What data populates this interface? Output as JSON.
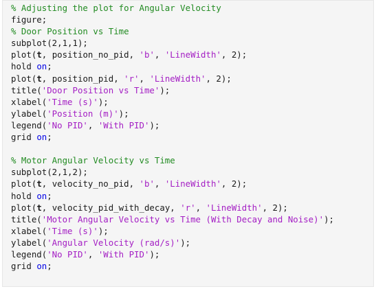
{
  "colors": {
    "background": "#f5f5f5",
    "text": "#1a1a1a",
    "comment": "#228b22",
    "string": "#a41ec4",
    "keyword": "#0000e6"
  },
  "code": {
    "lines": [
      [
        {
          "t": "% Adjusting the plot for Angular Velocity",
          "c": "comment"
        }
      ],
      [
        {
          "t": "figure;",
          "c": "plain"
        }
      ],
      [
        {
          "t": "% Door Position vs Time",
          "c": "comment"
        }
      ],
      [
        {
          "t": "subplot(2,1,1);",
          "c": "plain"
        }
      ],
      [
        {
          "t": "plot(",
          "c": "plain"
        },
        {
          "t": "t",
          "c": "bold"
        },
        {
          "t": ", position_no_pid, ",
          "c": "plain"
        },
        {
          "t": "'b'",
          "c": "string"
        },
        {
          "t": ", ",
          "c": "plain"
        },
        {
          "t": "'LineWidth'",
          "c": "string"
        },
        {
          "t": ", 2);",
          "c": "plain"
        }
      ],
      [
        {
          "t": "hold ",
          "c": "plain"
        },
        {
          "t": "on",
          "c": "keyword"
        },
        {
          "t": ";",
          "c": "plain"
        }
      ],
      [
        {
          "t": "plot(",
          "c": "plain"
        },
        {
          "t": "t",
          "c": "bold"
        },
        {
          "t": ", position_pid, ",
          "c": "plain"
        },
        {
          "t": "'r'",
          "c": "string"
        },
        {
          "t": ", ",
          "c": "plain"
        },
        {
          "t": "'LineWidth'",
          "c": "string"
        },
        {
          "t": ", 2);",
          "c": "plain"
        }
      ],
      [
        {
          "t": "title(",
          "c": "plain"
        },
        {
          "t": "'Door Position vs Time'",
          "c": "string"
        },
        {
          "t": ");",
          "c": "plain"
        }
      ],
      [
        {
          "t": "xlabel(",
          "c": "plain"
        },
        {
          "t": "'Time (s)'",
          "c": "string"
        },
        {
          "t": ");",
          "c": "plain"
        }
      ],
      [
        {
          "t": "ylabel(",
          "c": "plain"
        },
        {
          "t": "'Position (m)'",
          "c": "string"
        },
        {
          "t": ");",
          "c": "plain"
        }
      ],
      [
        {
          "t": "legend(",
          "c": "plain"
        },
        {
          "t": "'No PID'",
          "c": "string"
        },
        {
          "t": ", ",
          "c": "plain"
        },
        {
          "t": "'With PID'",
          "c": "string"
        },
        {
          "t": ");",
          "c": "plain"
        }
      ],
      [
        {
          "t": "grid ",
          "c": "plain"
        },
        {
          "t": "on",
          "c": "keyword"
        },
        {
          "t": ";",
          "c": "plain"
        }
      ],
      [],
      [
        {
          "t": "% Motor Angular Velocity vs Time",
          "c": "comment"
        }
      ],
      [
        {
          "t": "subplot(2,1,2);",
          "c": "plain"
        }
      ],
      [
        {
          "t": "plot(",
          "c": "plain"
        },
        {
          "t": "t",
          "c": "bold"
        },
        {
          "t": ", velocity_no_pid, ",
          "c": "plain"
        },
        {
          "t": "'b'",
          "c": "string"
        },
        {
          "t": ", ",
          "c": "plain"
        },
        {
          "t": "'LineWidth'",
          "c": "string"
        },
        {
          "t": ", 2);",
          "c": "plain"
        }
      ],
      [
        {
          "t": "hold ",
          "c": "plain"
        },
        {
          "t": "on",
          "c": "keyword"
        },
        {
          "t": ";",
          "c": "plain"
        }
      ],
      [
        {
          "t": "plot(",
          "c": "plain"
        },
        {
          "t": "t",
          "c": "bold"
        },
        {
          "t": ", velocity_pid_with_decay, ",
          "c": "plain"
        },
        {
          "t": "'r'",
          "c": "string"
        },
        {
          "t": ", ",
          "c": "plain"
        },
        {
          "t": "'LineWidth'",
          "c": "string"
        },
        {
          "t": ", 2);",
          "c": "plain"
        }
      ],
      [
        {
          "t": "title(",
          "c": "plain"
        },
        {
          "t": "'Motor Angular Velocity vs Time (With Decay and Noise)'",
          "c": "string"
        },
        {
          "t": ");",
          "c": "plain"
        }
      ],
      [
        {
          "t": "xlabel(",
          "c": "plain"
        },
        {
          "t": "'Time (s)'",
          "c": "string"
        },
        {
          "t": ");",
          "c": "plain"
        }
      ],
      [
        {
          "t": "ylabel(",
          "c": "plain"
        },
        {
          "t": "'Angular Velocity (rad/s)'",
          "c": "string"
        },
        {
          "t": ");",
          "c": "plain"
        }
      ],
      [
        {
          "t": "legend(",
          "c": "plain"
        },
        {
          "t": "'No PID'",
          "c": "string"
        },
        {
          "t": ", ",
          "c": "plain"
        },
        {
          "t": "'With PID'",
          "c": "string"
        },
        {
          "t": ");",
          "c": "plain"
        }
      ],
      [
        {
          "t": "grid ",
          "c": "plain"
        },
        {
          "t": "on",
          "c": "keyword"
        },
        {
          "t": ";",
          "c": "plain"
        }
      ]
    ]
  }
}
